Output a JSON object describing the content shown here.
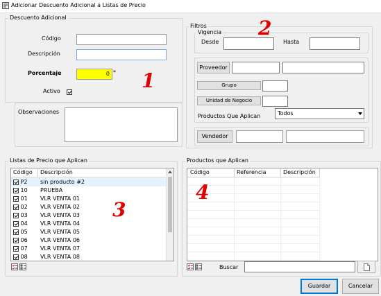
{
  "window": {
    "title": "Adicionar Descuento Adicional a Listas de Precio"
  },
  "descuento": {
    "group_title": "Descuento Adicional",
    "codigo_label": "Código",
    "codigo_value": "",
    "descripcion_label": "Descripción",
    "descripcion_value": "",
    "porcentaje_label": "Porcentaje",
    "porcentaje_value": "0",
    "required_mark": "*",
    "activo_label": "Activo",
    "activo_checked": true,
    "observaciones_label": "Observaciones",
    "observaciones_value": ""
  },
  "filtros": {
    "group_title": "Filtros",
    "vigencia_title": "Vigencia",
    "desde_label": "Desde",
    "hasta_label": "Hasta",
    "proveedor_button": "Proveedor",
    "grupo_button": "Grupo",
    "unidad_button": "Unidad de Negocio",
    "productos_label": "Productos Que Aplican",
    "productos_selected": "Todos",
    "vendedor_button": "Vendedor"
  },
  "listas": {
    "group_title": "Listas de Precio que Aplican",
    "columns": [
      "Código",
      "Descripción"
    ],
    "rows": [
      {
        "codigo": "P2",
        "descripcion": "sin producto #2",
        "checked": true
      },
      {
        "codigo": "10",
        "descripcion": "PRUEBA",
        "checked": true
      },
      {
        "codigo": "01",
        "descripcion": "VLR VENTA 01",
        "checked": true
      },
      {
        "codigo": "02",
        "descripcion": "VLR VENTA 02",
        "checked": true
      },
      {
        "codigo": "03",
        "descripcion": "VLR VENTA 03",
        "checked": true
      },
      {
        "codigo": "04",
        "descripcion": "VLR VENTA 04",
        "checked": true
      },
      {
        "codigo": "05",
        "descripcion": "VLR VENTA 05",
        "checked": true
      },
      {
        "codigo": "06",
        "descripcion": "VLR VENTA 06",
        "checked": true
      },
      {
        "codigo": "07",
        "descripcion": "VLR VENTA 07",
        "checked": true
      },
      {
        "codigo": "08",
        "descripcion": "VLR VENTA 08",
        "checked": true
      }
    ]
  },
  "productos": {
    "group_title": "Productos que Aplican",
    "columns": [
      "Código",
      "Referencia",
      "Descripción"
    ],
    "buscar_label": "Buscar",
    "buscar_value": ""
  },
  "footer": {
    "guardar": "Guardar",
    "cancelar": "Cancelar"
  },
  "annotations": [
    "1",
    "2",
    "3",
    "4"
  ],
  "colors": {
    "porcentaje_bg": "#ffff00",
    "annotation": "#e00000",
    "selected_row": "#e5f3ff"
  }
}
